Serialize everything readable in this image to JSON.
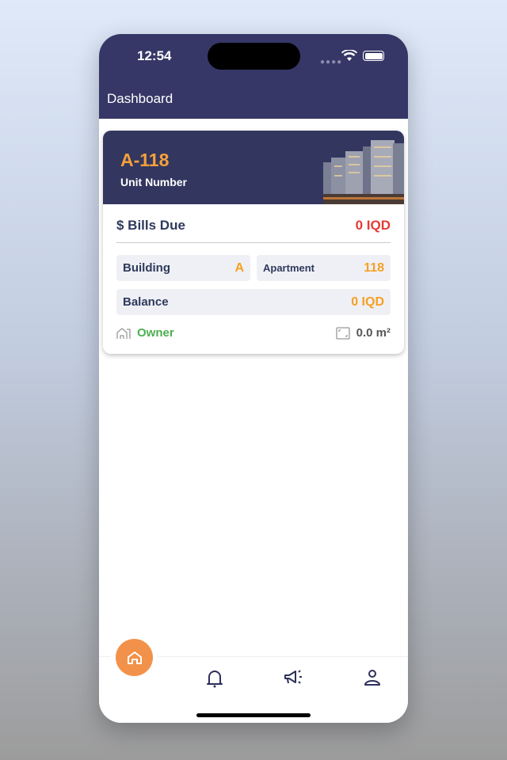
{
  "status": {
    "time": "12:54"
  },
  "header": {
    "title": "Dashboard"
  },
  "unit": {
    "number": "A-118",
    "label": "Unit Number"
  },
  "bills": {
    "label": "$ Bills Due",
    "value": "0 IQD"
  },
  "building": {
    "label": "Building",
    "value": "A"
  },
  "apartment": {
    "label": "Apartment",
    "value": "118"
  },
  "balance": {
    "label": "Balance",
    "value": "0 IQD"
  },
  "ownership": "Owner",
  "area": "0.0 m²",
  "colors": {
    "primary": "#363767",
    "accent": "#f5a023",
    "danger": "#e53b35",
    "success": "#4caf50",
    "home_button": "#f2924a"
  },
  "nav": [
    "home-icon",
    "bell-icon",
    "megaphone-icon",
    "user-icon"
  ]
}
